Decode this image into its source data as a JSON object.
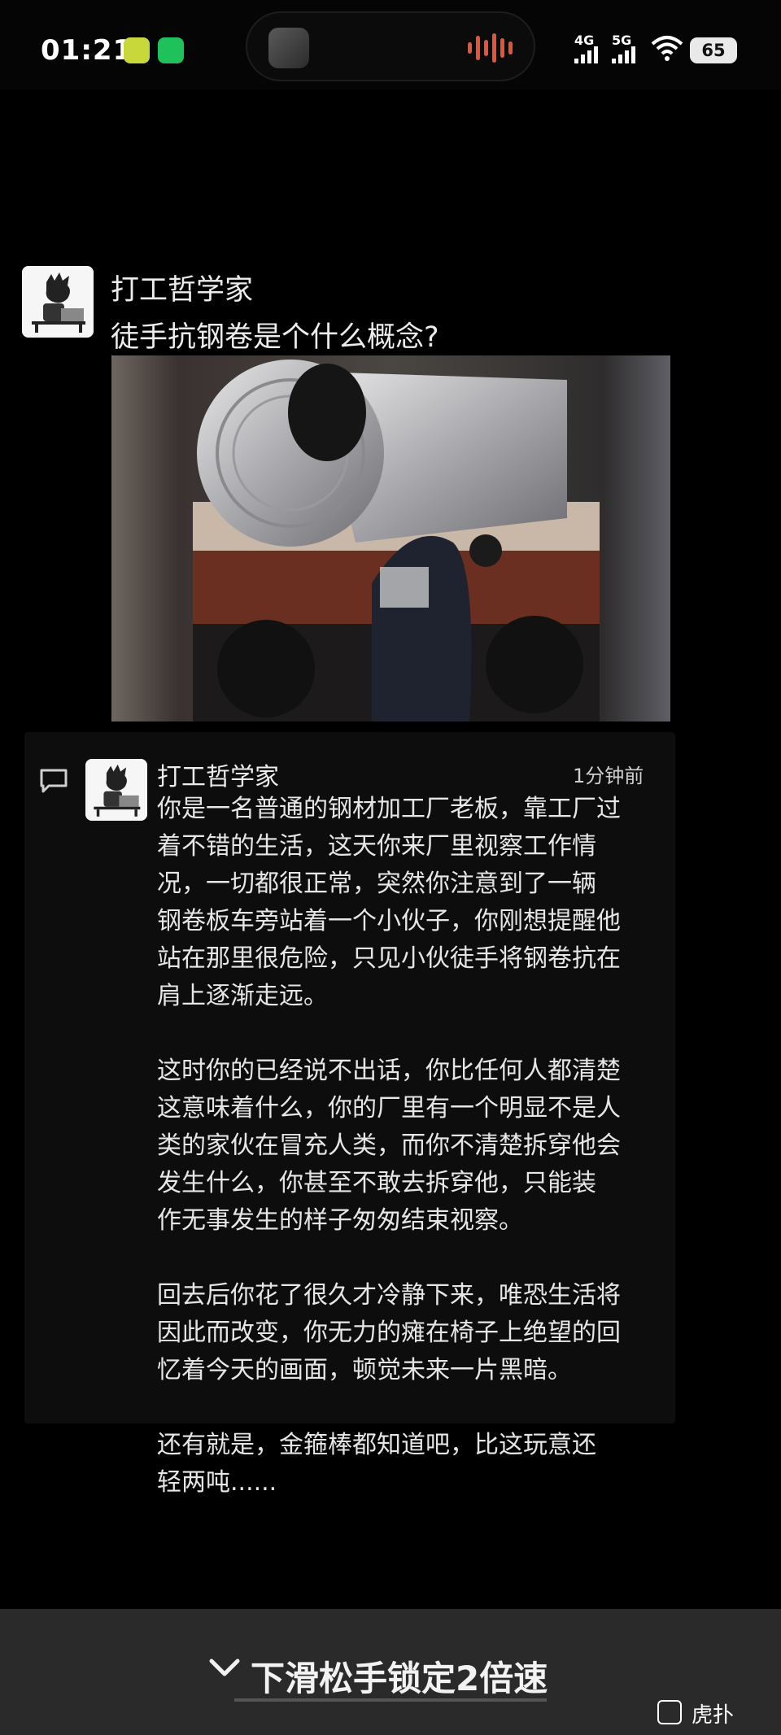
{
  "status_bar": {
    "time": "01:21",
    "network_1": "4G",
    "network_2": "5G",
    "battery": "65"
  },
  "post": {
    "author": "打工哲学家",
    "title": "徒手抗钢卷是个什么概念?"
  },
  "comment": {
    "author": "打工哲学家",
    "time": "1分钟前",
    "paragraphs": [
      "你是一名普通的钢材加工厂老板，靠工厂过\n着不错的生活，这天你来厂里视察工作情\n况，一切都很正常，突然你注意到了一辆\n钢卷板车旁站着一个小伙子，你刚想提醒他\n站在那里很危险，只见小伙徒手将钢卷抗在\n肩上逐渐走远。",
      "这时你的已经说不出话，你比任何人都清楚\n这意味着什么，你的厂里有一个明显不是人\n类的家伙在冒充人类，而你不清楚拆穿他会\n发生什么，你甚至不敢去拆穿他，只能装\n作无事发生的样子匆匆结束视察。",
      "回去后你花了很久才冷静下来，唯恐生活将\n因此而改变，你无力的瘫在椅子上绝望的回\n忆着今天的画面，顿觉未来一片黑暗。",
      "还有就是，金箍棒都知道吧，比这玩意还\n轻两吨......"
    ]
  },
  "bottom": {
    "hint": "下滑松手锁定2倍速",
    "watermark": "虎扑"
  },
  "colors": {
    "background": "#000000",
    "card": "#0d0d0d",
    "bottom_bar": "#2a2a2a",
    "text": "#e6e6e6"
  }
}
